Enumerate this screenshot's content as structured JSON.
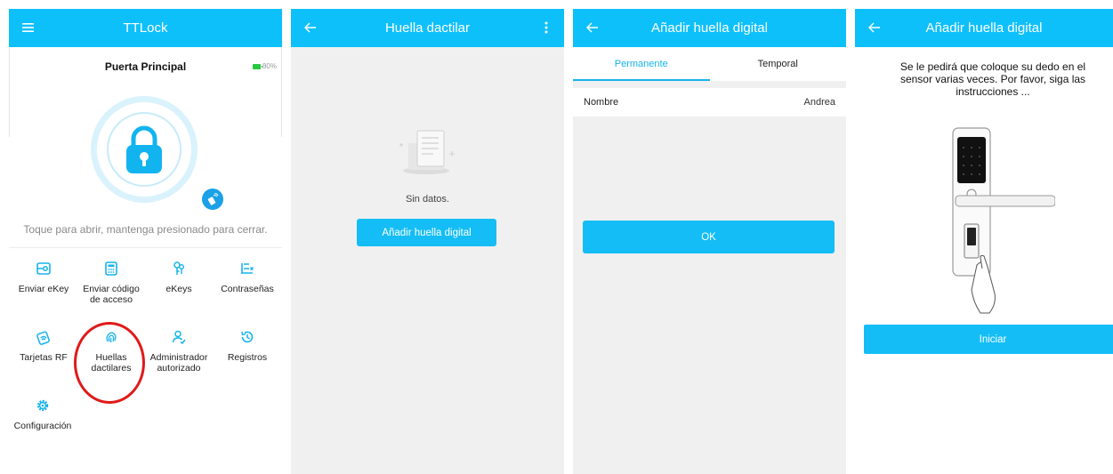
{
  "screens": {
    "home": {
      "title": "TTLock",
      "lock_name": "Puerta Principal",
      "battery": "80%",
      "hint": "Toque para abrir, mantenga presionado para cerrar.",
      "menu": [
        {
          "label": "Enviar eKey",
          "icon": "ekey-send-icon"
        },
        {
          "label": "Enviar código de acceso",
          "icon": "keypad-icon"
        },
        {
          "label": "eKeys",
          "icon": "keys-icon"
        },
        {
          "label": "Contraseñas",
          "icon": "password-list-icon"
        },
        {
          "label": "Tarjetas RF",
          "icon": "rf-card-icon"
        },
        {
          "label": "Huellas dactilares",
          "icon": "fingerprint-icon"
        },
        {
          "label": "Administrador autorizado",
          "icon": "admin-user-icon"
        },
        {
          "label": "Registros",
          "icon": "history-icon"
        },
        {
          "label": "Configuración",
          "icon": "settings-gear-icon"
        }
      ]
    },
    "fingerprint_list": {
      "title": "Huella dactilar",
      "empty_text": "Sin datos.",
      "add_button": "Añadir huella digital"
    },
    "add_fingerprint": {
      "title": "Añadir huella digital",
      "tabs": [
        "Permanente",
        "Temporal"
      ],
      "name_label": "Nombre",
      "name_value": "Andrea",
      "ok_button": "OK"
    },
    "add_fingerprint_instructions": {
      "title": "Añadir huella digital",
      "instructions": "Se le pedirá que coloque su dedo en el sensor varias veces. Por favor, siga las instrucciones ...",
      "start_button": "Iniciar"
    }
  },
  "colors": {
    "accent": "#0ec0fa",
    "highlight": "#e01a1a",
    "battery": "#28c840"
  }
}
